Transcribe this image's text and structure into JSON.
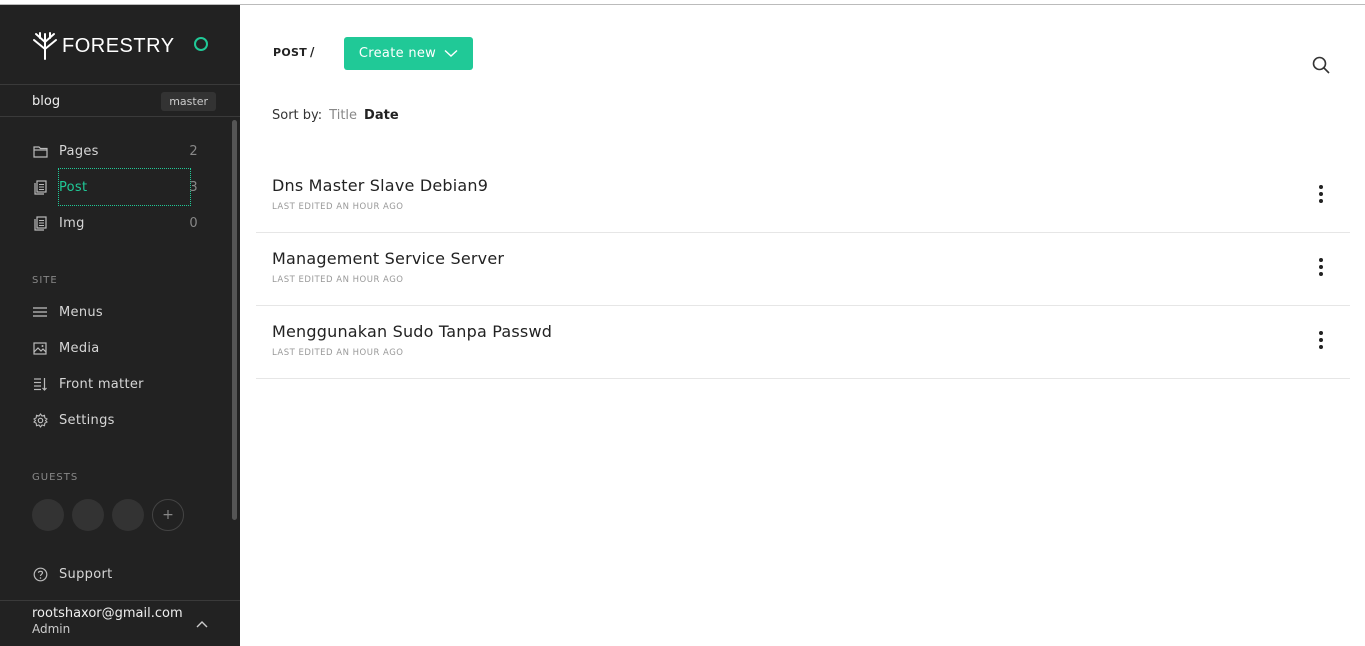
{
  "brand": {
    "logo_text": "FORESTRY",
    "accent": "#20c997"
  },
  "site": {
    "name": "blog",
    "branch": "master"
  },
  "nav": {
    "content": [
      {
        "label": "Pages",
        "count": "2",
        "icon": "folder-icon"
      },
      {
        "label": "Post",
        "count": "3",
        "icon": "document-stack-icon",
        "active": true
      },
      {
        "label": "Img",
        "count": "0",
        "icon": "document-stack-icon"
      }
    ],
    "site_section": "SITE",
    "site_items": [
      {
        "label": "Menus",
        "icon": "menu-icon"
      },
      {
        "label": "Media",
        "icon": "image-icon"
      },
      {
        "label": "Front matter",
        "icon": "front-matter-icon"
      },
      {
        "label": "Settings",
        "icon": "gear-icon"
      }
    ],
    "guests_section": "GUESTS",
    "add_guest": "+",
    "support": "Support"
  },
  "user": {
    "email": "rootshaxor@gmail.com",
    "role": "Admin"
  },
  "main": {
    "breadcrumb": "POST",
    "breadcrumb_sep": "/",
    "create_label": "Create new",
    "sort_label": "Sort by:",
    "sort_options": [
      {
        "label": "Title",
        "selected": false
      },
      {
        "label": "Date",
        "selected": true
      }
    ],
    "posts": [
      {
        "title": "Dns Master Slave Debian9",
        "meta": "LAST EDITED AN HOUR AGO"
      },
      {
        "title": "Management Service Server",
        "meta": "LAST EDITED AN HOUR AGO"
      },
      {
        "title": "Menggunakan Sudo Tanpa Passwd",
        "meta": "LAST EDITED AN HOUR AGO"
      }
    ]
  }
}
